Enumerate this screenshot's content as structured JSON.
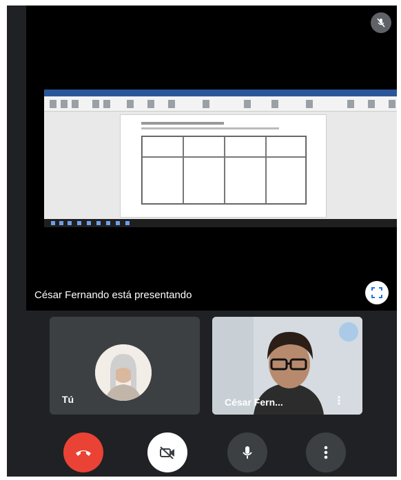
{
  "presentation": {
    "label": "César Fernando está presentando"
  },
  "tiles": {
    "self_name": "Tú",
    "peer_name": "César Fern..."
  },
  "controls": {
    "end_call": "end-call-icon",
    "camera": "camera-off-icon",
    "mic": "mic-icon",
    "more": "more-options-icon"
  },
  "colors": {
    "background": "#202124",
    "end_call": "#ea4335",
    "stage": "#000000"
  }
}
